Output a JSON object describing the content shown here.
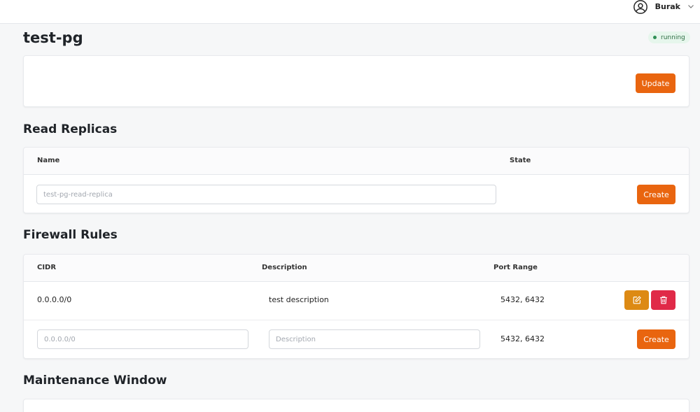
{
  "user": {
    "name": "Burak",
    "avatar_icon": "user-circle-icon",
    "menu_icon": "chevron-down-icon"
  },
  "page": {
    "title": "test-pg",
    "status": "running"
  },
  "update_card": {
    "update_label": "Update"
  },
  "read_replicas": {
    "title": "Read Replicas",
    "columns": [
      "Name",
      "State"
    ],
    "new_name_placeholder": "test-pg-read-replica",
    "create_label": "Create"
  },
  "firewall_rules": {
    "title": "Firewall Rules",
    "columns": [
      "CIDR",
      "Description",
      "Port Range"
    ],
    "rows": [
      {
        "cidr": "0.0.0.0/0",
        "description": "test description",
        "port_range": "5432, 6432"
      }
    ],
    "new_rule": {
      "cidr_placeholder": "0.0.0.0/0",
      "description_placeholder": "Description",
      "port_range": "5432, 6432",
      "create_label": "Create"
    }
  },
  "maintenance_window": {
    "title": "Maintenance Window"
  },
  "colors": {
    "accent": "#e9650f",
    "edit": "#dd8a14",
    "delete": "#e02a48",
    "status_bg": "#e6f6ec"
  }
}
